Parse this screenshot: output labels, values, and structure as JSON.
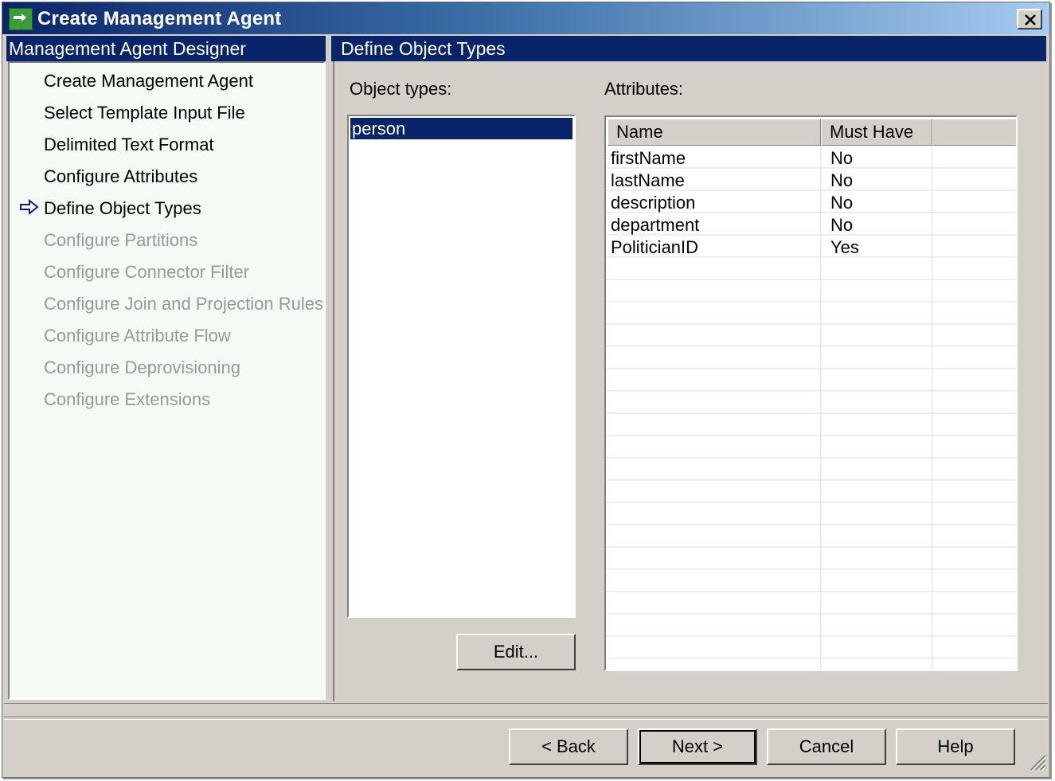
{
  "window": {
    "title": "Create Management Agent",
    "close_label": "×"
  },
  "left_header": "Management Agent Designer",
  "right_header": "Define Object Types",
  "nav": {
    "items": [
      {
        "label": "Create Management Agent",
        "state": "enabled"
      },
      {
        "label": "Select Template Input File",
        "state": "enabled"
      },
      {
        "label": "Delimited Text Format",
        "state": "enabled"
      },
      {
        "label": "Configure Attributes",
        "state": "enabled"
      },
      {
        "label": "Define Object Types",
        "state": "current"
      },
      {
        "label": "Configure Partitions",
        "state": "disabled"
      },
      {
        "label": "Configure Connector Filter",
        "state": "disabled"
      },
      {
        "label": "Configure Join and Projection Rules",
        "state": "disabled"
      },
      {
        "label": "Configure Attribute Flow",
        "state": "disabled"
      },
      {
        "label": "Configure Deprovisioning",
        "state": "disabled"
      },
      {
        "label": "Configure Extensions",
        "state": "disabled"
      }
    ],
    "current_icon": "right-arrow-icon"
  },
  "object_types": {
    "label": "Object types:",
    "items": [
      "person"
    ],
    "selected": "person",
    "edit_button": "Edit..."
  },
  "attributes": {
    "label": "Attributes:",
    "columns": [
      "Name",
      "Must Have"
    ],
    "rows": [
      {
        "name": "firstName",
        "must_have": "No"
      },
      {
        "name": "lastName",
        "must_have": "No"
      },
      {
        "name": "description",
        "must_have": "No"
      },
      {
        "name": "department",
        "must_have": "No"
      },
      {
        "name": "PoliticianID",
        "must_have": "Yes"
      }
    ]
  },
  "footer": {
    "back": "< Back",
    "next": "Next >",
    "cancel": "Cancel",
    "help": "Help"
  },
  "colors": {
    "selection": "#0a246a",
    "face": "#d4d0c8",
    "disabled_text": "#999999"
  }
}
